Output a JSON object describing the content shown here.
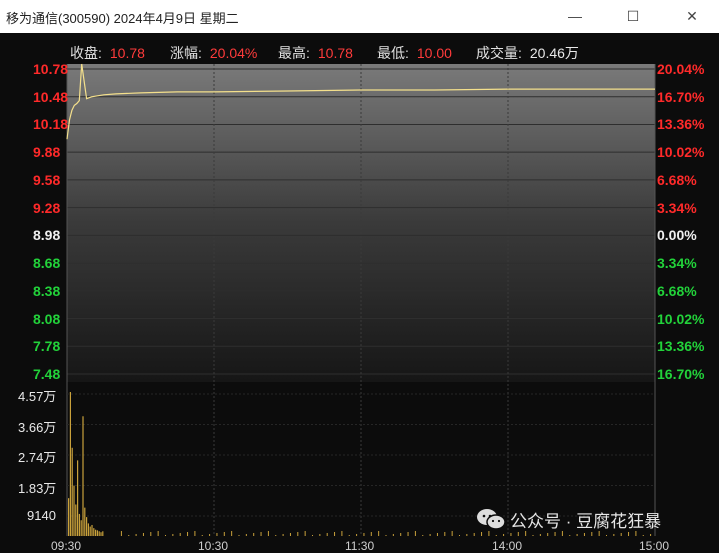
{
  "window": {
    "title": "移为通信(300590)  2024年4月9日   星期二",
    "minimize_glyph": "—",
    "maximize_glyph": "☐",
    "close_glyph": "✕"
  },
  "info": {
    "close_label": "收盘:",
    "close_value": "10.78",
    "change_label": "涨幅:",
    "change_value": "20.04%",
    "high_label": "最高:",
    "high_value": "10.78",
    "low_label": "最低:",
    "low_value": "10.00",
    "volume_label": "成交量:",
    "volume_value": "20.46万"
  },
  "price_axis": {
    "prices": [
      "10.78",
      "10.48",
      "10.18",
      "9.88",
      "9.58",
      "9.28",
      "8.98",
      "8.68",
      "8.38",
      "8.08",
      "7.78",
      "7.48"
    ],
    "pcts": [
      "20.04%",
      "16.70%",
      "13.36%",
      "10.02%",
      "6.68%",
      "3.34%",
      "0.00%",
      "3.34%",
      "6.68%",
      "10.02%",
      "13.36%",
      "16.70%"
    ]
  },
  "volume_axis": [
    "4.57万",
    "3.66万",
    "2.74万",
    "1.83万",
    "9140"
  ],
  "time_axis": [
    "09:30",
    "10:30",
    "11:30",
    "14:00",
    "15:00"
  ],
  "watermark": "公众号 · 豆腐花狂暴",
  "colors": {
    "up": "#ff2a2a",
    "down": "#22d23a",
    "price_line": "#f4e08c",
    "volume_bar": "#c9a13b"
  },
  "chart_data": {
    "type": "line",
    "title": "",
    "prev_close": 8.98,
    "ylim": [
      7.48,
      10.78
    ],
    "series": [
      {
        "name": "",
        "x": [
          0,
          1,
          2,
          3,
          4,
          5,
          6,
          8,
          10,
          15,
          20,
          30,
          45,
          60,
          90,
          120,
          150,
          180,
          210,
          240
        ],
        "values": [
          10.0,
          10.2,
          10.3,
          10.35,
          10.37,
          10.4,
          10.78,
          10.42,
          10.44,
          10.46,
          10.47,
          10.48,
          10.49,
          10.49,
          10.5,
          10.51,
          10.51,
          10.52,
          10.52,
          10.52
        ]
      }
    ],
    "volume": {
      "ylim": [
        0,
        45700
      ],
      "values": [
        12000,
        45700,
        28000,
        16000,
        10000,
        24000,
        7000,
        5000,
        38000,
        9000,
        6000,
        4000,
        3000,
        3500,
        2500,
        2000,
        1800,
        1500,
        1200,
        1500
      ]
    },
    "minutes_total": 240
  }
}
